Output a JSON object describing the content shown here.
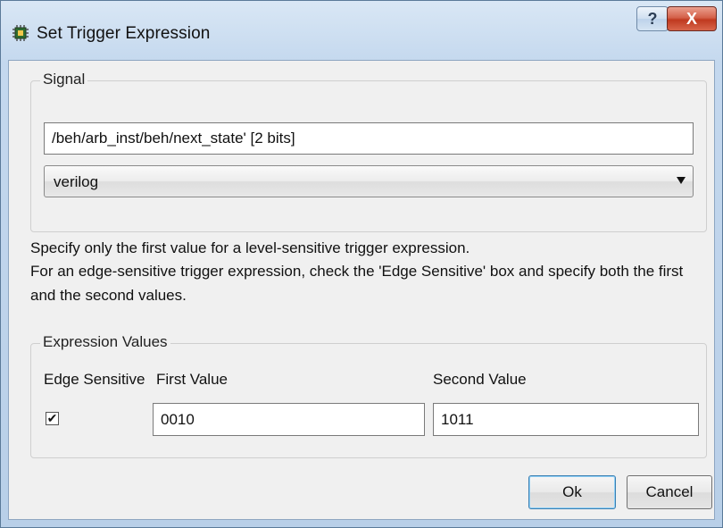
{
  "window": {
    "title": "Set Trigger Expression",
    "help_glyph": "?",
    "close_glyph": "X"
  },
  "signal": {
    "group_label": "Signal",
    "path_value": "/beh/arb_inst/beh/next_state' [2 bits]",
    "language": "verilog"
  },
  "description": {
    "line1": "Specify only the first value for a level-sensitive trigger expression.",
    "line2": "For an edge-sensitive trigger expression, check the 'Edge Sensitive' box and specify both the first",
    "line3": "and the second values."
  },
  "expression": {
    "group_label": "Expression Values",
    "edge_label": "Edge Sensitive",
    "first_label": "First Value",
    "second_label": "Second Value",
    "edge_checked": true,
    "check_glyph": "✔",
    "first_value": "0010",
    "second_value": "1011"
  },
  "buttons": {
    "ok": "Ok",
    "cancel": "Cancel"
  },
  "icons": {
    "app": "chip-icon",
    "help": "help-icon",
    "close": "close-icon",
    "dropdown": "chevron-down-icon",
    "check": "checkmark-icon"
  },
  "colors": {
    "title_bar": "#c4d8ee",
    "close_button": "#c0391f",
    "dialog_bg": "#f0f0f0",
    "default_button_border": "#3c7fb1"
  }
}
